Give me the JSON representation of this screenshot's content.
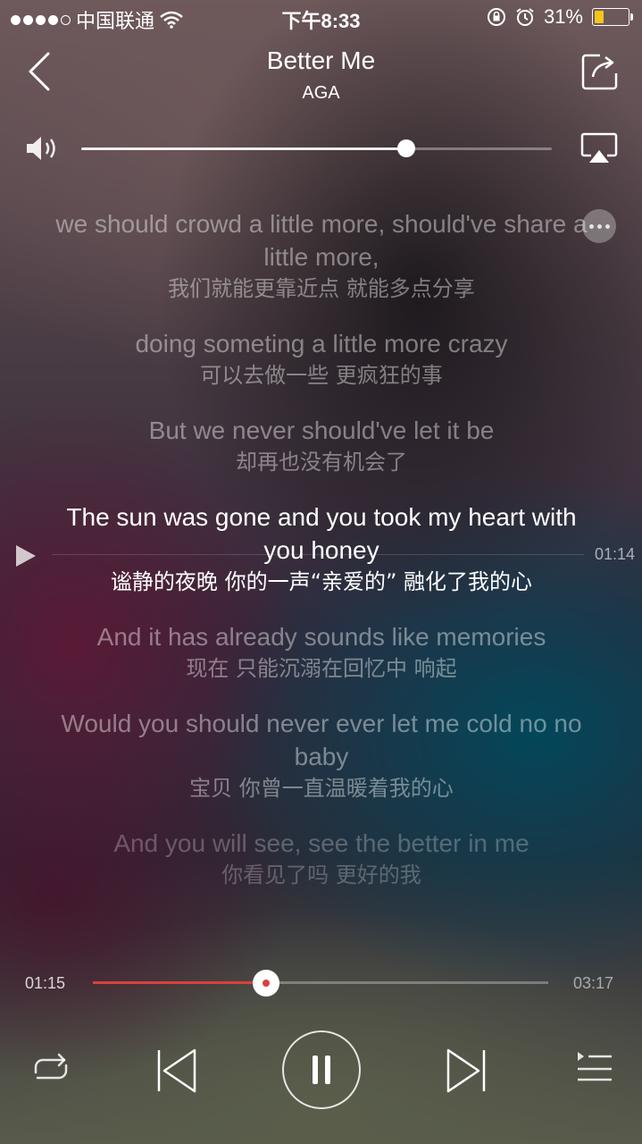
{
  "status_bar": {
    "carrier": "中国联通",
    "time": "下午8:33",
    "battery_percent": "31%",
    "battery_level": 0.31,
    "signal_bars": 4,
    "signal_total": 5
  },
  "header": {
    "title": "Better Me",
    "artist": "AGA"
  },
  "volume": {
    "level": 0.69
  },
  "lyrics": [
    {
      "en": "we should crowd a little more, should've share a little more,",
      "cn": "我们就能更靠近点 就能多点分享",
      "state": "past"
    },
    {
      "en": "doing someting a little more crazy",
      "cn": "可以去做一些 更疯狂的事",
      "state": "past"
    },
    {
      "en": "But we never should've let it be",
      "cn": "却再也没有机会了",
      "state": "past"
    },
    {
      "en": "The sun was gone and you took my heart with you honey",
      "cn": "谧静的夜晚  你的一声“亲爱的”  融化了我的心",
      "state": "active"
    },
    {
      "en": "And it has already sounds like memories",
      "cn": "现在 只能沉溺在回忆中 响起",
      "state": "upcoming"
    },
    {
      "en": "Would you should never ever let me cold no no baby",
      "cn": "宝贝  你曾一直温暖着我的心",
      "state": "upcoming"
    },
    {
      "en": "And you will see, see the better in me",
      "cn": "你看见了吗 更好的我",
      "state": "dim"
    }
  ],
  "lyric_seek_time": "01:14",
  "playback": {
    "elapsed": "01:15",
    "total": "03:17",
    "progress": 0.38
  },
  "colors": {
    "accent": "#d9413b",
    "battery": "#f5c518"
  },
  "icons": {
    "back": "chevron-left-icon",
    "share": "share-icon",
    "volume": "speaker-icon",
    "airplay": "airplay-icon",
    "more": "more-icon",
    "repeat": "repeat-icon",
    "prev": "previous-icon",
    "pause": "pause-icon",
    "next": "next-icon",
    "playlist": "playlist-icon"
  }
}
